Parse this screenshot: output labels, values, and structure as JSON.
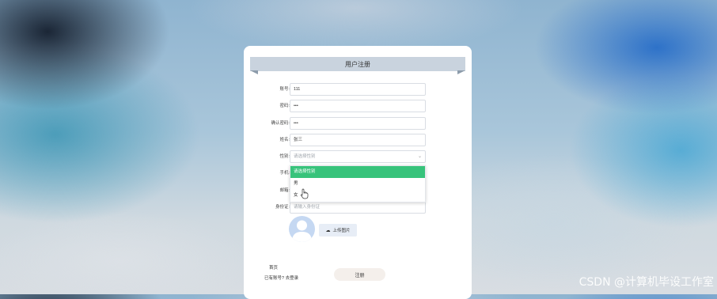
{
  "form": {
    "title": "用户注册",
    "fields": [
      {
        "label": "账号:",
        "value": "111",
        "placeholder": ""
      },
      {
        "label": "密码:",
        "value": "•••",
        "placeholder": ""
      },
      {
        "label": "确认密码:",
        "value": "•••",
        "placeholder": ""
      },
      {
        "label": "姓名:",
        "value": "张三",
        "placeholder": ""
      }
    ],
    "gender": {
      "label": "性别:",
      "placeholder": "请选择性别"
    },
    "phone": {
      "label": "手机:"
    },
    "email": {
      "label": "邮箱:"
    },
    "id_card": {
      "label": "身份证:",
      "placeholder": "请输入身份证"
    },
    "gender_options": [
      "请选择性别",
      "男",
      "女"
    ],
    "upload_label": "上传图片",
    "home_link": "首页",
    "login_link": "已有账号? 去登录",
    "submit_label": "注册"
  },
  "colors": {
    "selected_option": "#37c37b",
    "ribbon": "#c9d3de",
    "avatar": "#c5d8f2"
  },
  "watermark": "CSDN @计算机毕设工作室"
}
